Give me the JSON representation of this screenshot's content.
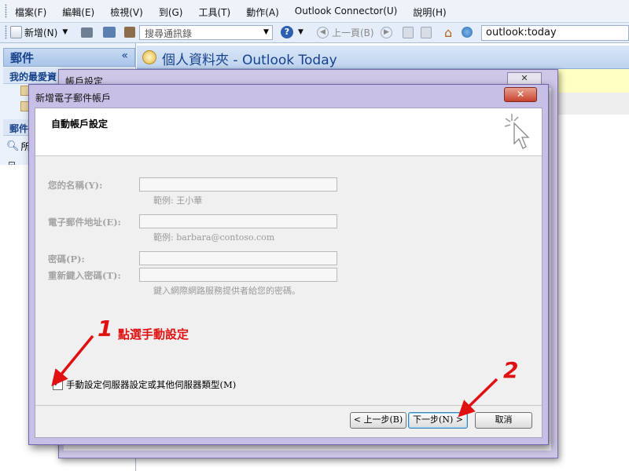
{
  "menubar": {
    "items": [
      "檔案(F)",
      "編輯(E)",
      "檢視(V)",
      "到(G)",
      "工具(T)",
      "動作(A)",
      "Outlook Connector(U)",
      "說明(H)"
    ]
  },
  "toolbar": {
    "new_label": "新增(N)",
    "search_placeholder": "搜尋通訊錄",
    "back_label": "上一頁(B)",
    "address": "outlook:today"
  },
  "leftpane": {
    "mail_header": "郵件",
    "collapse_glyph": "«",
    "favorites": "我的最愛資",
    "mail_section": "郵件",
    "all_items": "所",
    "tree_toggle": "⊟"
  },
  "rightpane": {
    "title": "個人資料夾 - Outlook Today"
  },
  "back_dialog": {
    "title": "帳戶設定"
  },
  "dialog": {
    "title": "新增電子郵件帳戶",
    "close_glyph": "✕",
    "header": "自動帳戶設定",
    "fields": {
      "name_label": "您的名稱(Y):",
      "name_example": "範例: 王小華",
      "email_label": "電子郵件地址(E):",
      "email_example": "範例: barbara@contoso.com",
      "password_label": "密碼(P):",
      "retype_label": "重新鍵入密碼(T):",
      "password_hint": "鍵入網際網路服務提供者給您的密碼。"
    },
    "manual_checkbox_label": "手動設定伺服器設定或其他伺服器類型(M)",
    "manual_checked": true,
    "buttons": {
      "back": "< 上一步(B)",
      "next": "下一步(N) >",
      "cancel": "取消"
    }
  },
  "annotations": {
    "step1_number": "1",
    "step1_text": "點選手動設定",
    "step2_number": "2",
    "color": "#e01010"
  }
}
